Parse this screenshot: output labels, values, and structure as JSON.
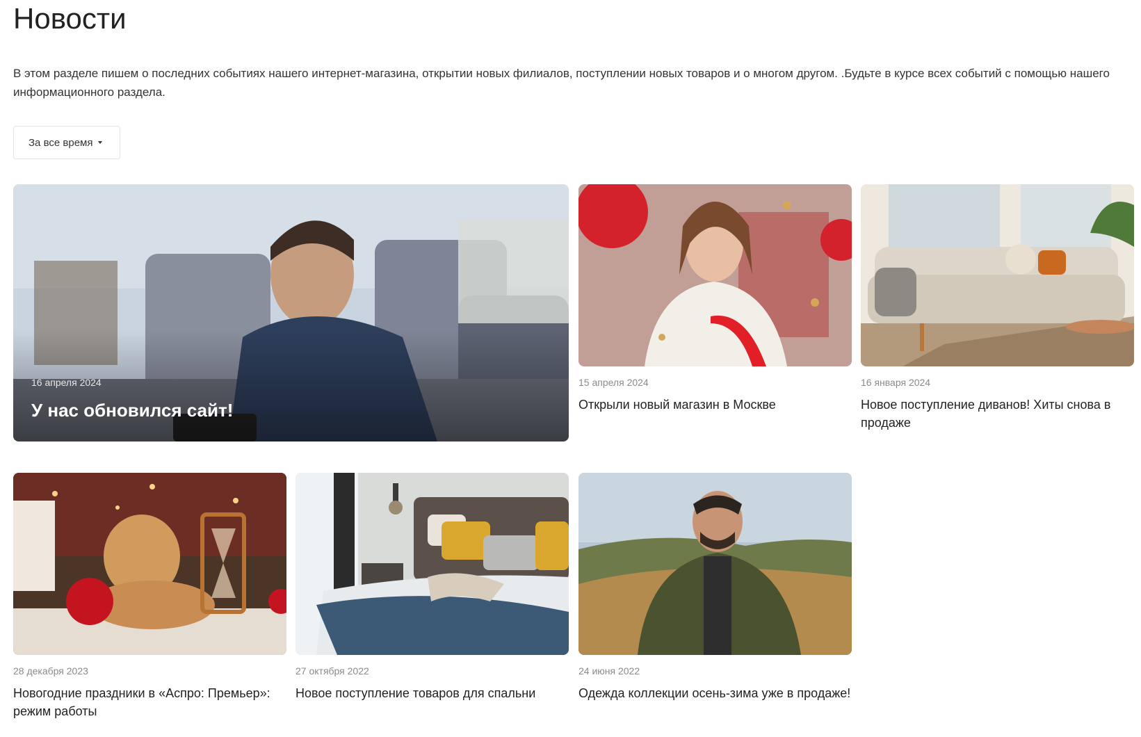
{
  "page": {
    "title": "Новости",
    "intro": "В этом разделе пишем о последних событиях нашего интернет-магазина, открытии новых филиалов, поступлении новых товаров и о многом другом. .Будьте в курсе всех событий с помощью нашего информационного раздела."
  },
  "filter": {
    "label": "За все время"
  },
  "news": [
    {
      "date": "16 апреля 2024",
      "title": "У нас обновился сайт!"
    },
    {
      "date": "15 апреля 2024",
      "title": "Открыли новый магазин в Москве"
    },
    {
      "date": "16 января 2024",
      "title": "Новое поступление диванов! Хиты снова в продаже"
    },
    {
      "date": "28 декабря 2023",
      "title": "Новогодние праздники в «Аспро: Премьер»: режим работы"
    },
    {
      "date": "27 октября 2022",
      "title": "Новое поступление товаров для спальни"
    },
    {
      "date": "24 июня 2022",
      "title": "Одежда коллекции осень-зима уже в продаже!"
    }
  ]
}
